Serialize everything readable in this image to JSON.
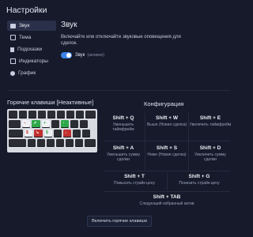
{
  "page": {
    "title": "Настройки"
  },
  "sidebar": {
    "items": [
      {
        "label": "Звук",
        "icon": "speaker-icon"
      },
      {
        "label": "Тема",
        "icon": "theme-icon"
      },
      {
        "label": "Подсказки",
        "icon": "tips-icon"
      },
      {
        "label": "Индикаторы",
        "icon": "indicators-icon"
      },
      {
        "label": "График",
        "icon": "chart-icon"
      }
    ]
  },
  "sound": {
    "title": "Звук",
    "description": "Включайте или отключайте звуковые оповещения для сделок.",
    "toggle_label": "Звук",
    "toggle_state": "(активно)",
    "enabled": true
  },
  "hotkeys": {
    "title": "Горячие клавиши [Неактивные]",
    "config_title": "Конфигурация",
    "shortcuts": [
      {
        "combo": "Shift + Q",
        "desc": "Уменьшить таймфрейм"
      },
      {
        "combo": "Shift + W",
        "desc": "Выше (Новая сделка)"
      },
      {
        "combo": "Shift + E",
        "desc": "Увеличить таймфрейм"
      },
      {
        "combo": "Shift + A",
        "desc": "Уменьшить сумму сделки"
      },
      {
        "combo": "Shift + S",
        "desc": "Ниже (Новая сделка)"
      },
      {
        "combo": "Shift + D",
        "desc": "Увеличить сумму сделки"
      },
      {
        "combo": "Shift + T",
        "desc": "Повысить страйк-цену"
      },
      {
        "combo": "Shift + G",
        "desc": "Понизить страйк-цену"
      },
      {
        "combo": "Shift + TAB",
        "desc": "Следующий избранный актив"
      }
    ],
    "enable_button": "Включить горячие клавиши"
  },
  "colors": {
    "accent": "#3b82e6",
    "up": "#2fa84a",
    "down": "#c23030"
  }
}
